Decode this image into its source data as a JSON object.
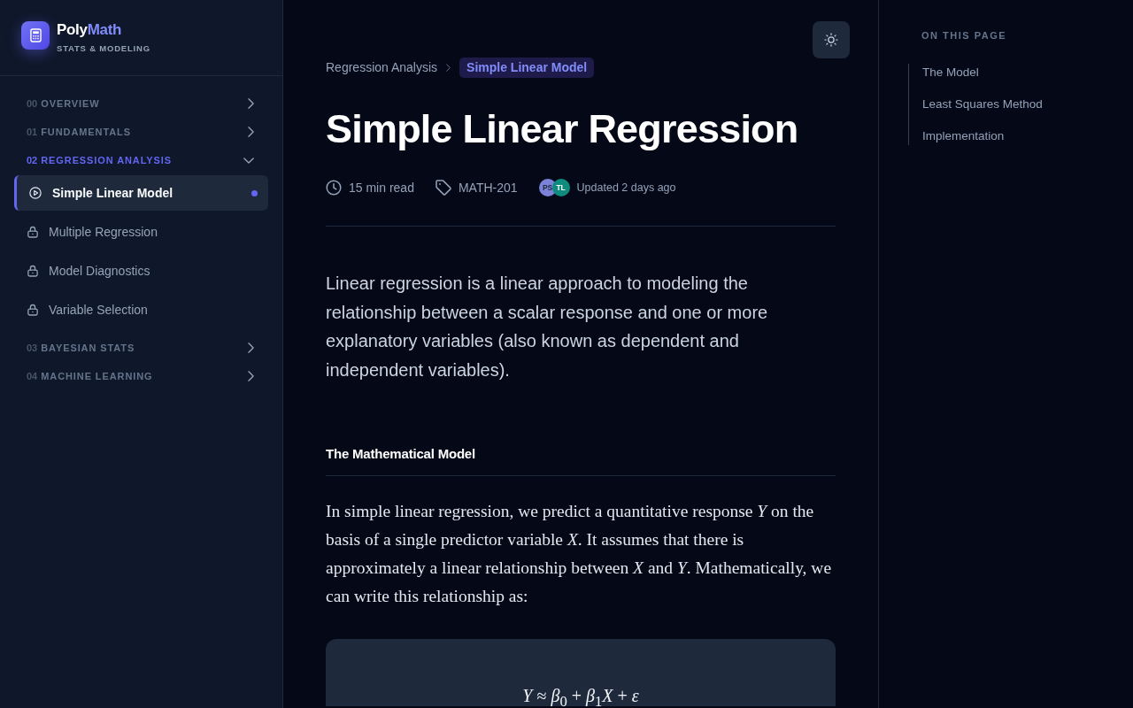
{
  "sidebar": {
    "brand": {
      "name": "Poly",
      "name_accent": "Math",
      "tagline": "STATS & MODELING"
    },
    "sections": [
      {
        "number": "00",
        "label": "OVERVIEW",
        "selected": false,
        "expanded": false
      },
      {
        "number": "01",
        "label": "FUNDAMENTALS",
        "selected": false,
        "expanded": false
      },
      {
        "number": "02",
        "label": "REGRESSION ANALYSIS",
        "selected": true,
        "expanded": true,
        "items": [
          {
            "label": "Simple Linear Model",
            "selected": true,
            "locked": false
          },
          {
            "label": "Multiple Regression",
            "selected": false,
            "locked": true
          },
          {
            "label": "Model Diagnostics",
            "selected": false,
            "locked": true
          },
          {
            "label": "Variable Selection",
            "selected": false,
            "locked": true
          }
        ]
      },
      {
        "number": "03",
        "label": "BAYESIAN STATS",
        "selected": false,
        "expanded": false
      },
      {
        "number": "04",
        "label": "MACHINE LEARNING",
        "selected": false,
        "expanded": false
      }
    ]
  },
  "article": {
    "breadcrumb": [
      {
        "label": "Regression Analysis",
        "selected": false
      },
      {
        "label": "Simple Linear Model",
        "selected": true
      }
    ],
    "title": "Simple Linear Regression",
    "meta": {
      "read_time": "15 min read",
      "tag": "MATH-201",
      "authors": [
        {
          "initials": "PS",
          "color": "#7b82d8"
        },
        {
          "initials": "TL",
          "color": "#0f8b7d"
        }
      ],
      "updated": "Updated 2 days ago"
    },
    "lead": "Linear regression is a linear approach to modeling the relationship between a scalar response and one or more explanatory variables (also known as dependent and independent variables).",
    "sections": [
      {
        "heading": "The Mathematical Model",
        "paragraph": "In simple linear regression, we predict a quantitative response *Y* on the basis of a single predictor variable *X*. It assumes that there is approximately a linear relationship between *X* and *Y*. Mathematically, we can write this relationship as:",
        "equation": "*Y* ≈ *β*$_{0}$ + *β*$_{1}$*X* + *ε*"
      }
    ]
  },
  "toc": {
    "title": "ON THIS PAGE",
    "items": [
      {
        "label": "The Model",
        "selected": false
      },
      {
        "label": "Least Squares Method",
        "selected": false
      },
      {
        "label": "Implementation",
        "selected": false
      }
    ]
  }
}
